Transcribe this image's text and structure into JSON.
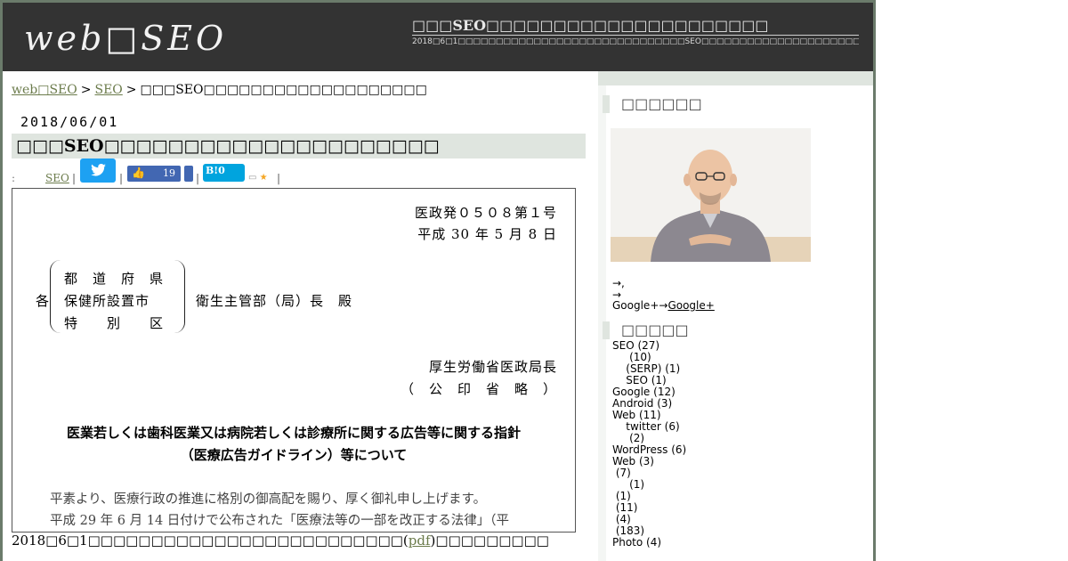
{
  "header": {
    "logo": "web□SEO",
    "title": "□□□SEO□□□□□□□□□□□□□□□□□□□□□",
    "description": "2018□6□1□□□□□□□□□□□□□□□□□□□□□□□□□□□□□□SEO□□□□□□□□□□□□□□□□□□□□□□□□□□□□□□□□□□□□SEO□□□□□□□□□□□□□"
  },
  "breadcrumb": {
    "home": "web□SEO",
    "sep1": ">",
    "category": "SEO",
    "sep2": ">",
    "current": "□□□SEO□□□□□□□□□□□□□□□□□□□"
  },
  "post": {
    "date": "2018/06/01",
    "title": "□□□SEO□□□□□□□□□□□□□□□□□□□□□",
    "meta_colon": ":",
    "meta_category": "SEO",
    "bar": "|",
    "facebook_count": "19",
    "hatena_label": "B!0",
    "after_text_pre": "2018□6□1□□□□□□□□□□□□□□□□□□□□□□□□□(",
    "after_link": "pdf",
    "after_text_post": ")□□□□□□□□□"
  },
  "document": {
    "number": "医政発０５０８第１号",
    "date": "平成 30 年 5 月 8 日",
    "addr_prefix": "各",
    "addr_line1": "都　道　府　県",
    "addr_line2": "保健所設置市",
    "addr_line3": "特　　別　　区",
    "addressee": "衛生主管部（局）長　殿",
    "sender": "厚生労働省医政局長",
    "seal": "（　公　印　省　略　）",
    "subject_line1": "医業若しくは歯科医業又は病院若しくは診療所に関する広告等に関する指針",
    "subject_line2": "（医療広告ガイドライン）等について",
    "body_line1": "平素より、医療行政の推進に格別の御高配を賜り、厚く御礼申し上げます。",
    "body_line2": "平成 29 年 6 月 14 日付けで公布された「医療法等の一部を改正する法律」（平"
  },
  "sidebar": {
    "profile_heading": "□□□□□□",
    "arrow1": "→,",
    "arrow2": "→",
    "google_text": "Google+→",
    "google_link": "Google+",
    "categories_heading": "□□□□□",
    "categories": [
      "SEO (27)",
      "     (10)",
      "    (SERP) (1)",
      "    SEO (1)",
      "Google (12)",
      "Android (3)",
      "Web (11)",
      "    twitter (6)",
      "     (2)",
      "WordPress (6)",
      "Web (3)",
      " (7)",
      "     (1)",
      " (1)",
      " (11)",
      " (4)",
      " (183)",
      "Photo (4)"
    ]
  },
  "colors": {
    "header_bg": "#333333",
    "title_band": "#dfe5df",
    "link": "#6b7b4b",
    "twitter": "#1da1f2",
    "facebook": "#4267b2",
    "hatena": "#00a4de"
  }
}
